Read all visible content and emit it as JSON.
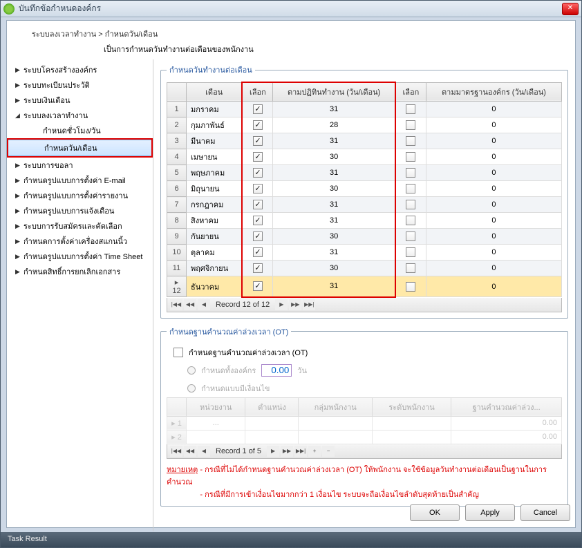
{
  "window": {
    "title": "บันทึกข้อกำหนดองค์กร"
  },
  "breadcrumb": {
    "path": "ระบบลงเวลาทำงาน > กำหนดวัน/เดือน",
    "sub": "เป็นการกำหนดวันทำงานต่อเดือนของพนักงาน"
  },
  "sidebar": {
    "items": [
      {
        "label": "ระบบโครงสร้างองค์กร",
        "type": "parent"
      },
      {
        "label": "ระบบทะเบียนประวัติ",
        "type": "parent"
      },
      {
        "label": "ระบบเงินเดือน",
        "type": "parent"
      },
      {
        "label": "ระบบลงเวลาทำงาน",
        "type": "parent",
        "expanded": true
      },
      {
        "label": "กำหนดชั่วโมง/วัน",
        "type": "child"
      },
      {
        "label": "กำหนดวัน/เดือน",
        "type": "child",
        "selected": true
      },
      {
        "label": "ระบบการขอลา",
        "type": "parent"
      },
      {
        "label": "กำหนดรูปแบบการตั้งค่า E-mail",
        "type": "parent"
      },
      {
        "label": "กำหนดรูปแบบการตั้งค่ารายงาน",
        "type": "parent"
      },
      {
        "label": "กำหนดรูปแบบการแจ้งเตือน",
        "type": "parent"
      },
      {
        "label": "ระบบการรับสมัครและคัดเลือก",
        "type": "parent"
      },
      {
        "label": "กำหนดการตั้งค่าเครื่องสแกนนิ้ว",
        "type": "parent"
      },
      {
        "label": "กำหนดรูปแบบการตั้งค่า Time Sheet",
        "type": "parent"
      },
      {
        "label": "กำหนดสิทธิ์การยกเลิกเอกสาร",
        "type": "parent"
      }
    ]
  },
  "fieldset1": {
    "legend": "กำหนดวันทำงานต่อเดือน"
  },
  "grid": {
    "headers": {
      "month": "เดือน",
      "sel1": "เลือก",
      "days1": "ตามปฏิทินทำงาน (วัน/เดือน)",
      "sel2": "เลือก",
      "days2": "ตามมาตรฐานองค์กร (วัน/เดือน)"
    },
    "rows": [
      {
        "n": "1",
        "name": "มกราคม",
        "c1": true,
        "d1": "31",
        "c2": false,
        "d2": "0"
      },
      {
        "n": "2",
        "name": "กุมภาพันธ์",
        "c1": true,
        "d1": "28",
        "c2": false,
        "d2": "0"
      },
      {
        "n": "3",
        "name": "มีนาคม",
        "c1": true,
        "d1": "31",
        "c2": false,
        "d2": "0"
      },
      {
        "n": "4",
        "name": "เมษายน",
        "c1": true,
        "d1": "30",
        "c2": false,
        "d2": "0"
      },
      {
        "n": "5",
        "name": "พฤษภาคม",
        "c1": true,
        "d1": "31",
        "c2": false,
        "d2": "0"
      },
      {
        "n": "6",
        "name": "มิถุนายน",
        "c1": true,
        "d1": "30",
        "c2": false,
        "d2": "0"
      },
      {
        "n": "7",
        "name": "กรกฎาคม",
        "c1": true,
        "d1": "31",
        "c2": false,
        "d2": "0"
      },
      {
        "n": "8",
        "name": "สิงหาคม",
        "c1": true,
        "d1": "31",
        "c2": false,
        "d2": "0"
      },
      {
        "n": "9",
        "name": "กันยายน",
        "c1": true,
        "d1": "30",
        "c2": false,
        "d2": "0"
      },
      {
        "n": "10",
        "name": "ตุลาคม",
        "c1": true,
        "d1": "31",
        "c2": false,
        "d2": "0"
      },
      {
        "n": "11",
        "name": "พฤศจิกายน",
        "c1": true,
        "d1": "30",
        "c2": false,
        "d2": "0"
      },
      {
        "n": "12",
        "name": "ธันวาคม",
        "c1": true,
        "d1": "31",
        "c2": false,
        "d2": "0",
        "sel": true
      }
    ],
    "nav": "Record 12 of 12"
  },
  "fieldset2": {
    "legend": "กำหนดฐานคำนวณค่าล่วงเวลา (OT)"
  },
  "ot": {
    "checkbox": "กำหนดฐานคำนวณค่าล่วงเวลา (OT)",
    "radio1": "กำหนดทั้งองค์กร",
    "value": "0.00",
    "unit": "วัน",
    "radio2": "กำหนดแบบมีเงื่อนไข"
  },
  "grid2": {
    "headers": {
      "c1": "หน่วยงาน",
      "c2": "ตำแหน่ง",
      "c3": "กลุ่มพนักงาน",
      "c4": "ระดับพนักงาน",
      "c5": "ฐานคำนวณค่าล่วง..."
    },
    "rows": [
      {
        "n": "1",
        "c1": "...",
        "val": "0.00"
      },
      {
        "n": "2",
        "c1": "",
        "val": "0.00"
      }
    ],
    "nav": "Record 1 of 5"
  },
  "note": {
    "label": "หมายเหตุ",
    "line1": "- กรณีที่ไม่ได้กำหนดฐานคำนวณค่าล่วงเวลา (OT) ให้พนักงาน จะใช้ข้อมูลวันทำงานต่อเดือนเป็นฐานในการคำนวณ",
    "line2": "- กรณีที่มีการเข้าเงื่อนไขมากกว่า 1 เงื่อนไข ระบบจะถือเงื่อนไขลำดับสุดท้ายเป็นสำคัญ"
  },
  "buttons": {
    "ok": "OK",
    "apply": "Apply",
    "cancel": "Cancel"
  },
  "taskbar": "Task Result"
}
